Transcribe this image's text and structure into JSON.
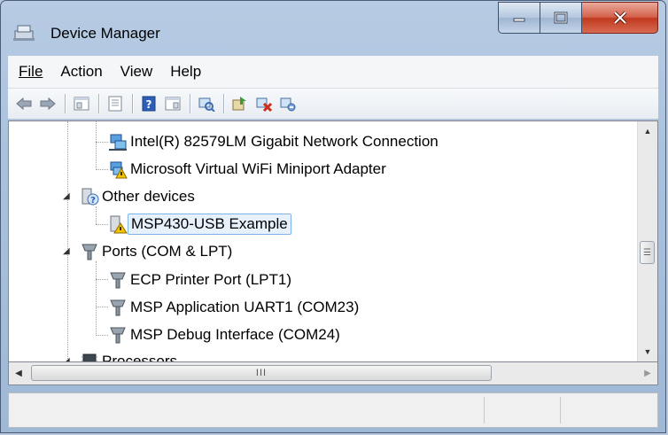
{
  "window": {
    "title": "Device Manager"
  },
  "menu": [
    {
      "label": "File"
    },
    {
      "label": "Action"
    },
    {
      "label": "View"
    },
    {
      "label": "Help"
    }
  ],
  "toolbar_icons": [
    "back-arrow-icon",
    "forward-arrow-icon",
    "properties-icon",
    "view-list-icon",
    "help-icon",
    "console-tree-icon",
    "scan-hardware-icon",
    "update-driver-icon",
    "uninstall-icon",
    "disable-device-icon"
  ],
  "tree": {
    "items": [
      {
        "label": "Intel(R) 82579LM Gigabit Network Connection",
        "icon": "network-adapter-icon"
      },
      {
        "label": "Microsoft Virtual WiFi Miniport Adapter",
        "icon": "network-adapter-warning-icon"
      },
      {
        "label": "Other devices",
        "icon": "unknown-device-category-icon"
      },
      {
        "label": "MSP430-USB Example",
        "icon": "unknown-device-warning-icon",
        "selected": true
      },
      {
        "label": "Ports (COM & LPT)",
        "icon": "port-category-icon"
      },
      {
        "label": "ECP Printer Port (LPT1)",
        "icon": "port-icon"
      },
      {
        "label": "MSP Application UART1 (COM23)",
        "icon": "port-icon"
      },
      {
        "label": "MSP Debug Interface (COM24)",
        "icon": "port-icon"
      },
      {
        "label": "Processors",
        "icon": "processor-icon"
      }
    ]
  },
  "scrollbar": {
    "thumb_grip": "III"
  },
  "colors": {
    "selection": "#e6f1fb",
    "selection_border": "#7eb4ea",
    "close_button": "#c7432a"
  }
}
